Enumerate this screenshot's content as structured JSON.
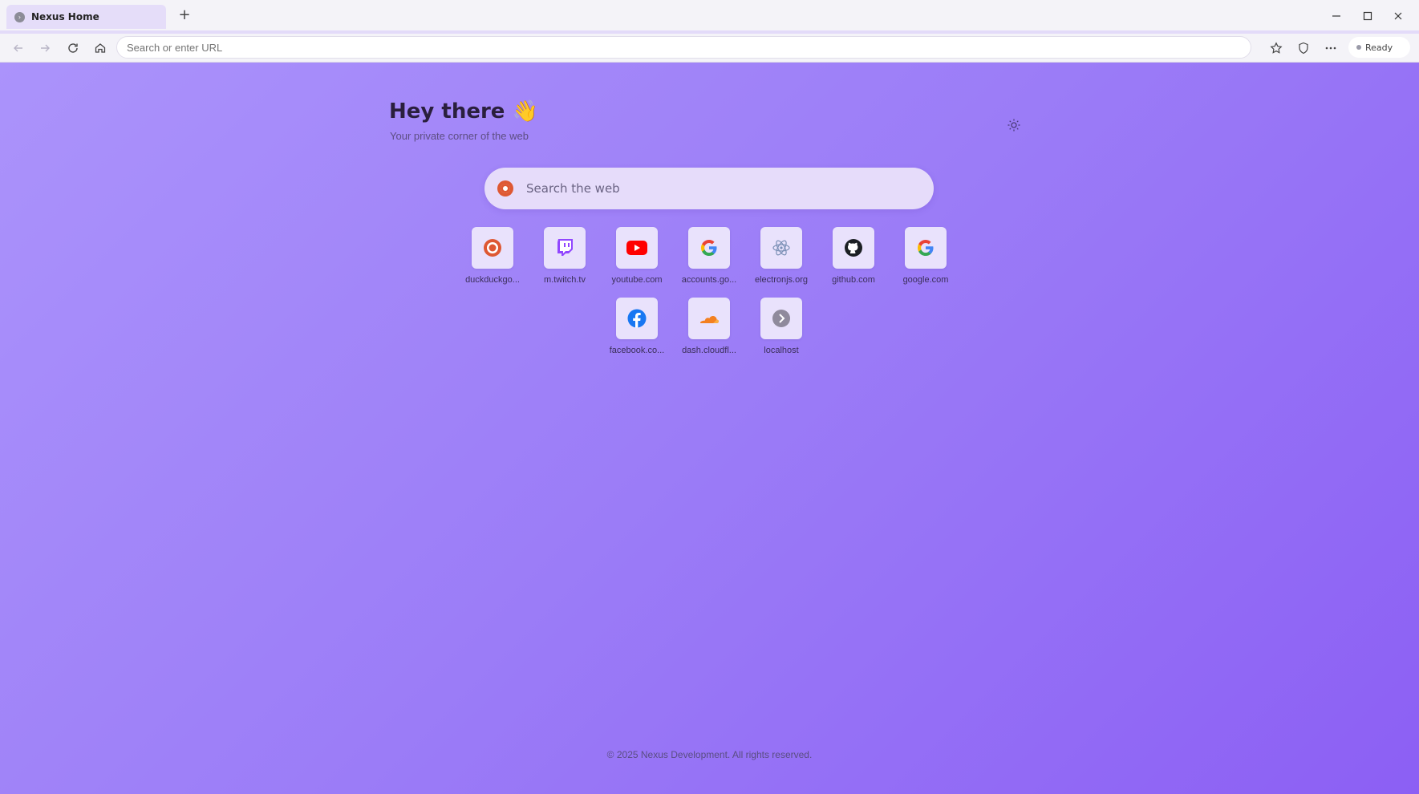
{
  "tab": {
    "title": "Nexus Home",
    "favicon": "chevron-right-icon"
  },
  "toolbar": {
    "url_value": "",
    "url_placeholder": "Search or enter URL",
    "status": "Ready"
  },
  "page": {
    "greeting": "Hey there 👋",
    "subtitle": "Your private corner of the web",
    "search_placeholder": "Search the web",
    "footer": "© 2025 Nexus Development. All rights reserved."
  },
  "shortcuts": [
    {
      "label": "duckduckgo...",
      "icon": "duckduckgo-icon"
    },
    {
      "label": "m.twitch.tv",
      "icon": "twitch-icon"
    },
    {
      "label": "youtube.com",
      "icon": "youtube-icon"
    },
    {
      "label": "accounts.go...",
      "icon": "google-icon"
    },
    {
      "label": "electronjs.org",
      "icon": "electron-icon"
    },
    {
      "label": "github.com",
      "icon": "github-icon"
    },
    {
      "label": "google.com",
      "icon": "google-icon"
    },
    {
      "label": "facebook.co...",
      "icon": "facebook-icon"
    },
    {
      "label": "dash.cloudfl...",
      "icon": "cloudflare-icon"
    },
    {
      "label": "localhost",
      "icon": "chevron-right-icon"
    }
  ],
  "colors": {
    "accent": "#9b7cf7",
    "tab_active": "#e5ddf9",
    "search_bg": "#e6dcfa"
  }
}
